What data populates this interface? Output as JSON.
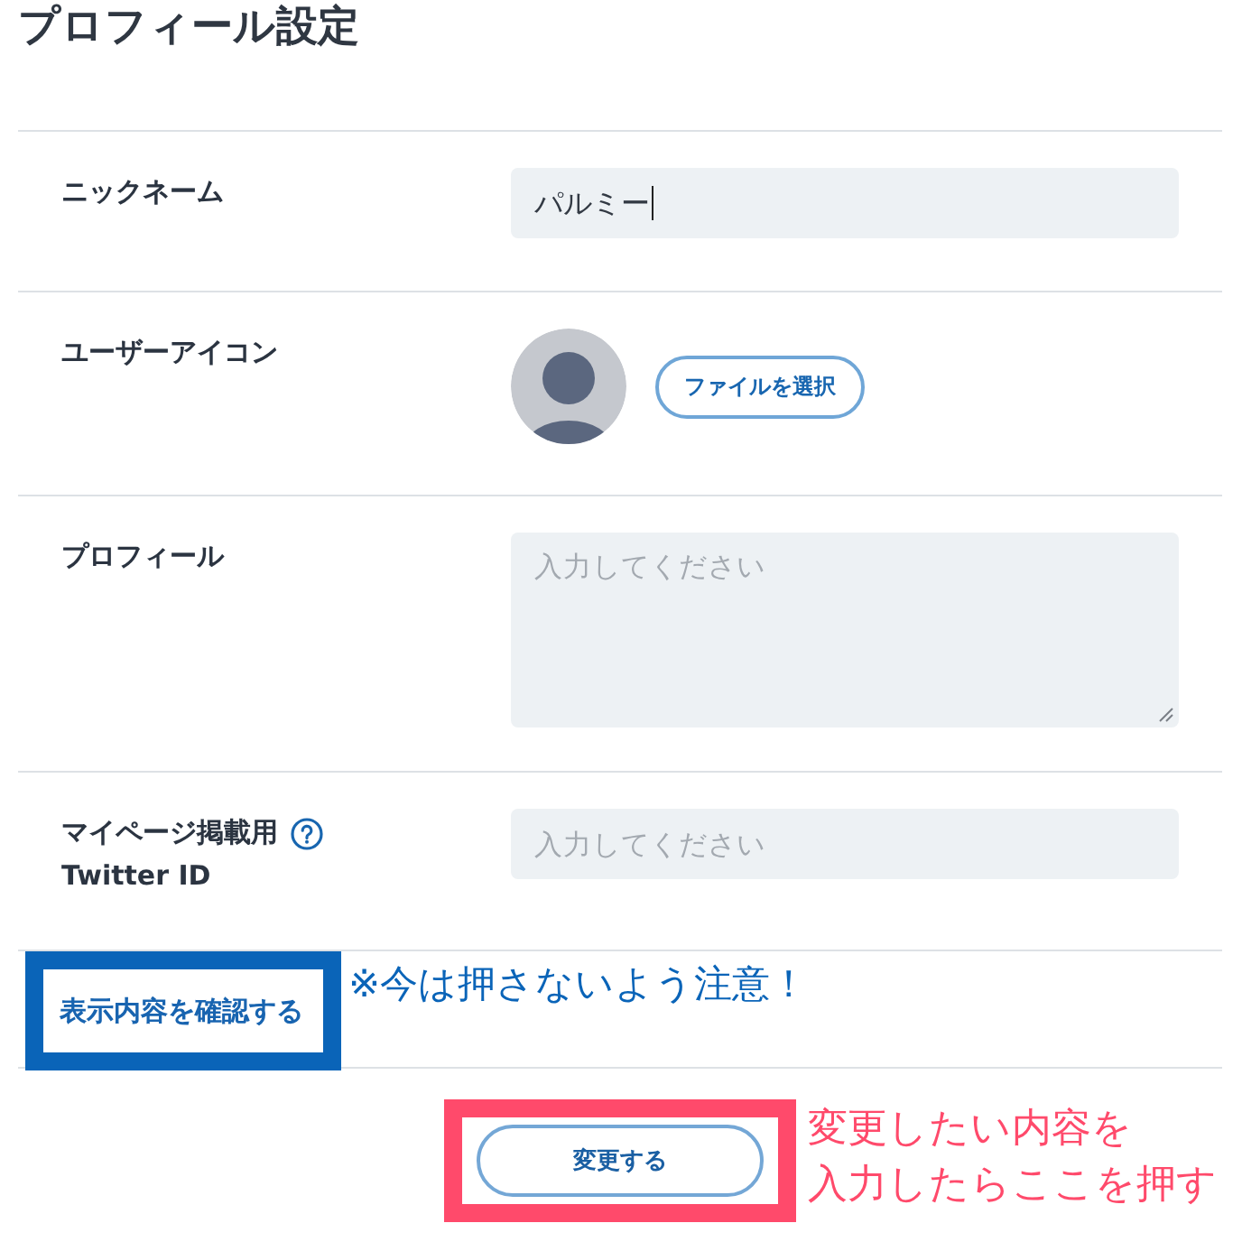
{
  "title": "プロフィール設定",
  "rows": [
    {
      "kind": "text",
      "label": "ニックネーム",
      "help": false,
      "field": {
        "value": "パルミー",
        "focused": true
      }
    },
    {
      "kind": "avatar",
      "label": "ユーザーアイコン",
      "help": false,
      "button": "ファイルを選択"
    },
    {
      "kind": "textarea",
      "label": "プロフィール",
      "help": false,
      "field": {
        "placeholder": "入力してください",
        "focused": false
      }
    },
    {
      "kind": "text",
      "label": "マイページ掲載用",
      "sublabel": "Twitter ID",
      "help": true,
      "field": {
        "placeholder": "入力してください",
        "focused": false
      }
    }
  ],
  "actions": [
    {
      "kind": "link",
      "label": "表示内容を確認する",
      "note": {
        "lines": [
          "※今は押さないよう注意！"
        ],
        "color": "#0a64b8"
      }
    },
    {
      "kind": "button",
      "label": "変更する",
      "note": {
        "lines": [
          "変更したい内容を",
          "入力したらここを押す"
        ],
        "color": "#ff4a6b"
      }
    }
  ]
}
